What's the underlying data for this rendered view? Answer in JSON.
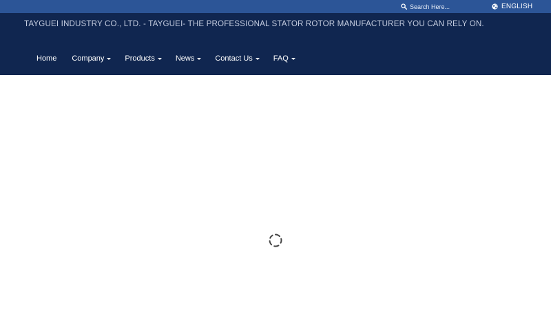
{
  "topbar": {
    "search": {
      "placeholder": "Search Here...",
      "icon": "search-icon"
    },
    "language": {
      "label": "ENGLISH",
      "icon": "globe-icon"
    }
  },
  "header": {
    "tagline": "TAYGUEI INDUSTRY CO., LTD. - TAYGUEI- THE PROFESSIONAL STATOR ROTOR MANUFACTURER YOU CAN RELY ON."
  },
  "nav": {
    "items": [
      {
        "label": "Home",
        "dropdown": false
      },
      {
        "label": "Company",
        "dropdown": true
      },
      {
        "label": "Products",
        "dropdown": true
      },
      {
        "label": "News",
        "dropdown": true
      },
      {
        "label": "Contact Us",
        "dropdown": true
      },
      {
        "label": "FAQ",
        "dropdown": true
      }
    ]
  },
  "main": {
    "loading": true,
    "icon": "loading-spinner-icon"
  },
  "colors": {
    "topbar": "#2c5597",
    "header": "#102650",
    "tagline": "#c5cde0",
    "nav_text": "#ffffff",
    "background": "#ffffff",
    "spinner": "#444444"
  }
}
